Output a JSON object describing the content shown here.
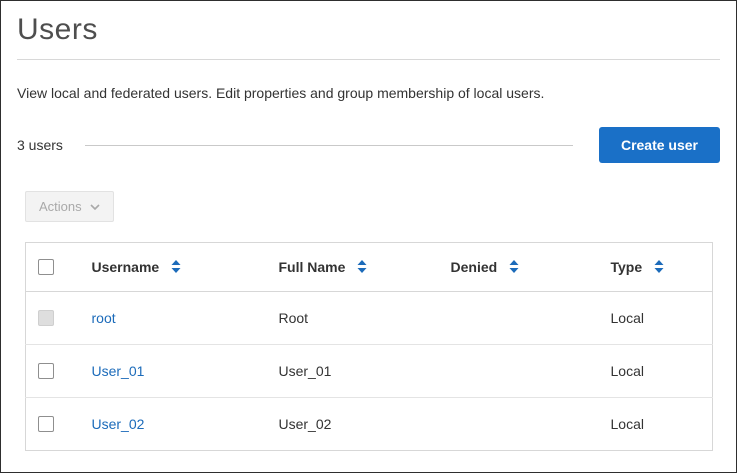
{
  "page": {
    "title": "Users",
    "description": "View local and federated users. Edit properties and group membership of local users.",
    "count_label": "3 users",
    "create_button_label": "Create user",
    "actions_button_label": "Actions"
  },
  "table": {
    "columns": [
      "Username",
      "Full Name",
      "Denied",
      "Type"
    ],
    "rows": [
      {
        "username": "root",
        "full_name": "Root",
        "denied": "",
        "type": "Local",
        "checkbox_state": "disabled"
      },
      {
        "username": "User_01",
        "full_name": "User_01",
        "denied": "",
        "type": "Local",
        "checkbox_state": "unchecked"
      },
      {
        "username": "User_02",
        "full_name": "User_02",
        "denied": "",
        "type": "Local",
        "checkbox_state": "unchecked"
      }
    ]
  },
  "colors": {
    "primary_button": "#1a70c7",
    "link": "#1c6bba",
    "sort_icon": "#1c6bba",
    "title_text": "#4e4e4e"
  },
  "icons": {
    "sort": "sort-arrows-icon",
    "actions_chevron": "chevron-down-icon"
  }
}
